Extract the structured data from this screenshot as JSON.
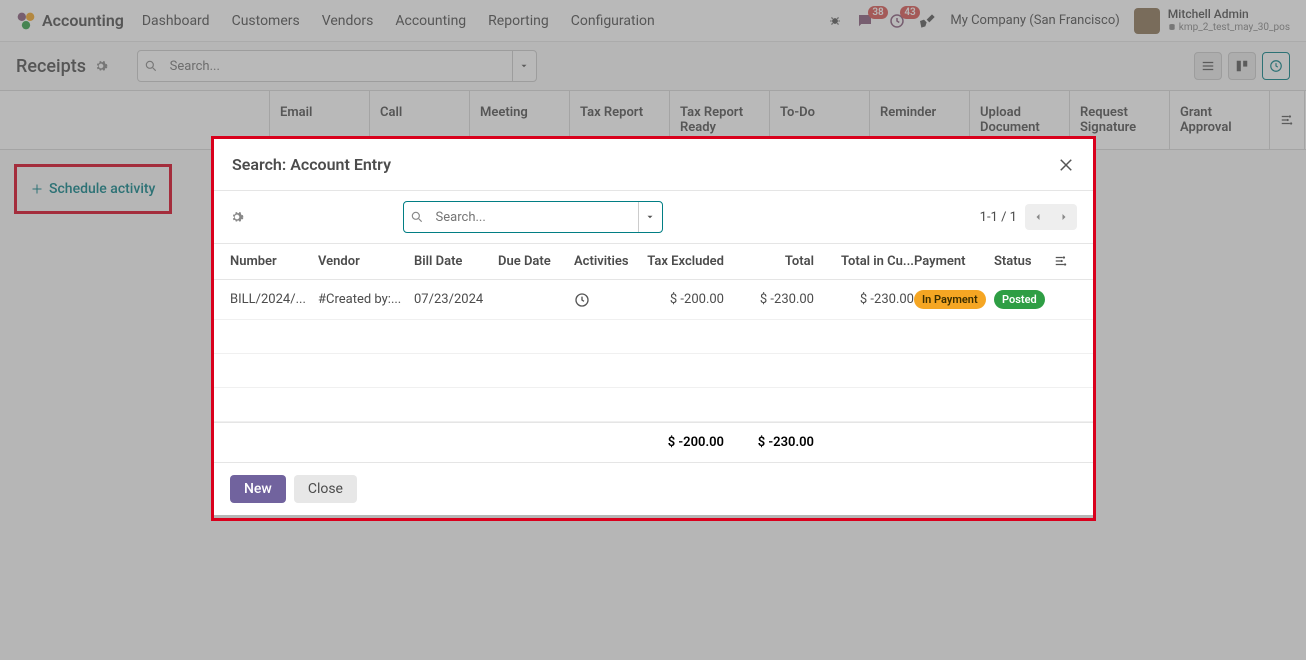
{
  "app_name": "Accounting",
  "nav": [
    "Dashboard",
    "Customers",
    "Vendors",
    "Accounting",
    "Reporting",
    "Configuration"
  ],
  "messages_badge": "38",
  "activities_badge": "43",
  "company": "My Company (San Francisco)",
  "user": {
    "name": "Mitchell Admin",
    "db": "kmp_2_test_may_30_pos"
  },
  "breadcrumb": "Receipts",
  "main_search_placeholder": "Search...",
  "columns": [
    "Email",
    "Call",
    "Meeting",
    "Tax Report",
    "Tax Report Ready",
    "To-Do",
    "Reminder",
    "Upload Document",
    "Request Signature",
    "Grant Approval"
  ],
  "schedule_activity_label": "Schedule activity",
  "modal": {
    "title": "Search: Account Entry",
    "search_placeholder": "Search...",
    "pager": "1-1 / 1",
    "headers": {
      "number": "Number",
      "vendor": "Vendor",
      "billdate": "Bill Date",
      "duedate": "Due Date",
      "activities": "Activities",
      "taxex": "Tax Excluded",
      "total": "Total",
      "totalcu": "Total in Cu...",
      "payment": "Payment",
      "status": "Status"
    },
    "row": {
      "number": "BILL/2024/...",
      "vendor": "#Created by:...",
      "billdate": "07/23/2024",
      "duedate": "",
      "taxex": "$ -200.00",
      "total": "$ -230.00",
      "totalcu": "$ -230.00",
      "payment": "In Payment",
      "status": "Posted"
    },
    "sum": {
      "taxex": "$ -200.00",
      "total": "$ -230.00"
    },
    "new_label": "New",
    "close_label": "Close"
  }
}
